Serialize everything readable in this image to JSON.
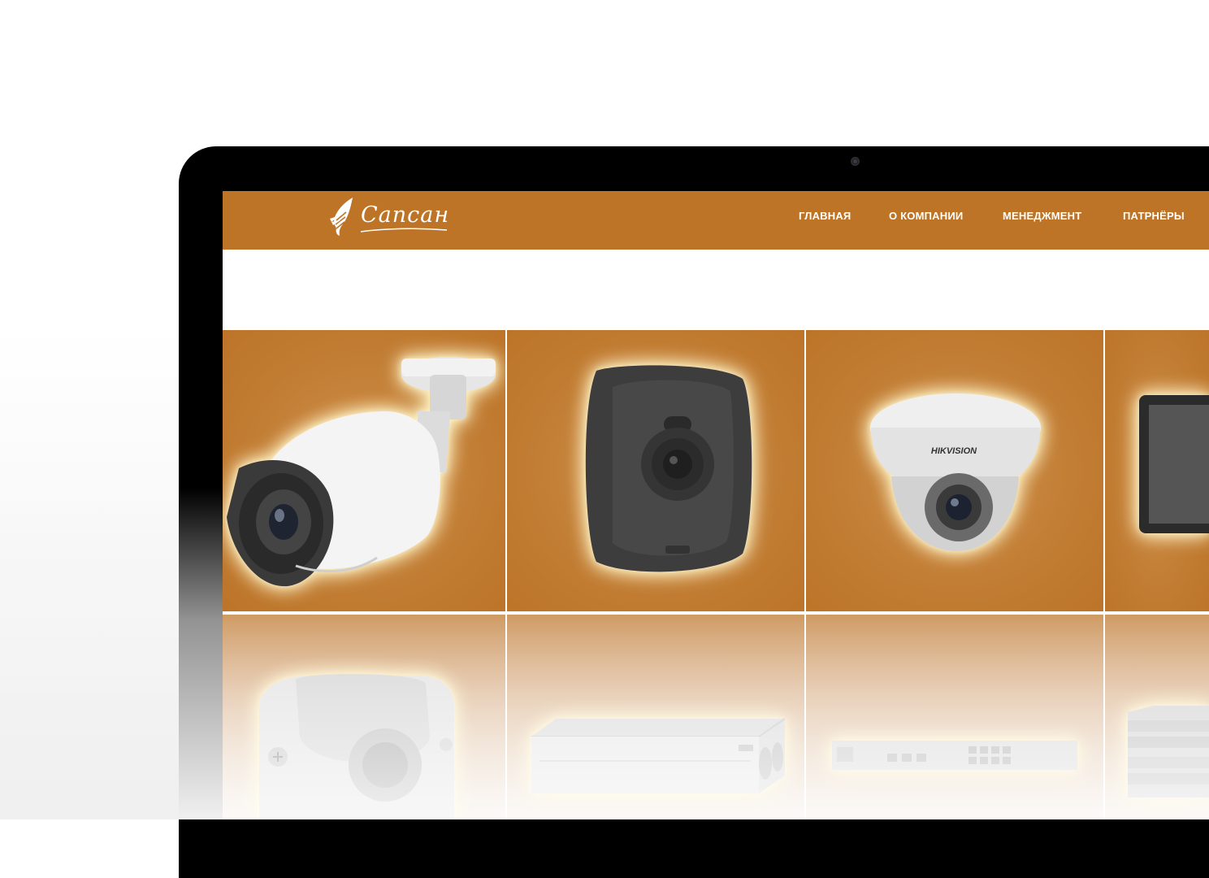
{
  "site": {
    "logo_text": "Сапсан"
  },
  "nav": {
    "items": [
      {
        "label": "ГЛАВНАЯ"
      },
      {
        "label": "О КОМПАНИИ"
      },
      {
        "label": "МЕНЕДЖМЕНТ"
      },
      {
        "label": "ПАТРНЁРЫ"
      }
    ]
  },
  "products": [
    {
      "name": "bullet-camera"
    },
    {
      "name": "cube-camera"
    },
    {
      "name": "dome-camera",
      "brand": "HIKVISION"
    },
    {
      "name": "monitor"
    },
    {
      "name": "vehicle-camera"
    },
    {
      "name": "video-recorder"
    },
    {
      "name": "network-switch"
    },
    {
      "name": "server-rack"
    }
  ],
  "colors": {
    "brand": "#bd7427",
    "bezel": "#000000"
  }
}
